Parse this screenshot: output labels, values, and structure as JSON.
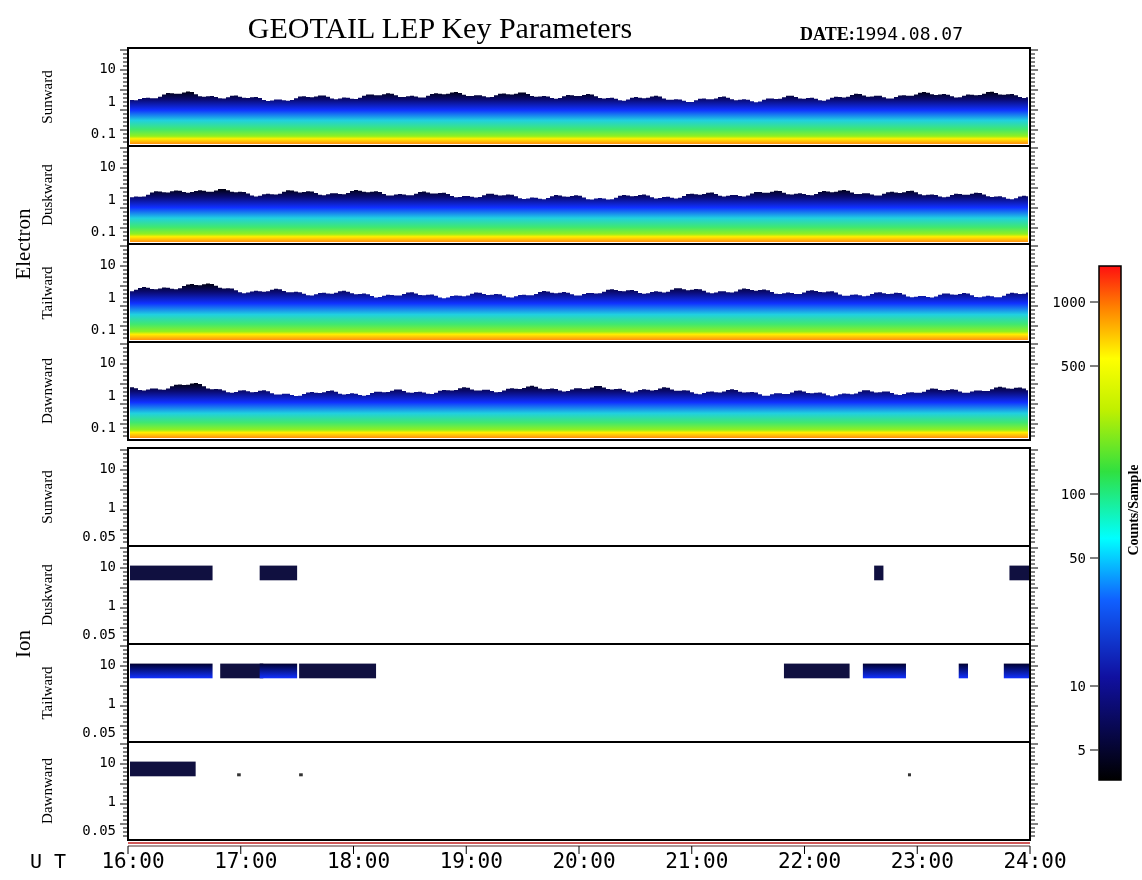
{
  "title": "GEOTAIL LEP Key Parameters",
  "date": {
    "label": "DATE:",
    "value": "1994.08.07"
  },
  "groups": [
    {
      "name": "Electron",
      "kind": "band",
      "panels": [
        {
          "label": "Sunward",
          "yticks": [
            "10",
            "1",
            "0.1"
          ]
        },
        {
          "label": "Duskward",
          "yticks": [
            "10",
            "1",
            "0.1"
          ]
        },
        {
          "label": "Tailward",
          "yticks": [
            "10",
            "1",
            "0.1"
          ]
        },
        {
          "label": "Dawnward",
          "yticks": [
            "10",
            "1",
            "0.1"
          ]
        }
      ]
    },
    {
      "name": "Ion",
      "kind": "sparse",
      "panels": [
        {
          "label": "Sunward",
          "yticks": [
            "10",
            "1",
            "0.05"
          ]
        },
        {
          "label": "Duskward",
          "yticks": [
            "10",
            "1",
            "0.05"
          ]
        },
        {
          "label": "Tailward",
          "yticks": [
            "10",
            "1",
            "0.05"
          ]
        },
        {
          "label": "Dawnward",
          "yticks": [
            "10",
            "1",
            "0.05"
          ]
        }
      ]
    }
  ],
  "time_axis": {
    "label": "U T",
    "ticks": [
      "16:00",
      "17:00",
      "18:00",
      "19:00",
      "20:00",
      "21:00",
      "22:00",
      "23:00",
      "24:00"
    ]
  },
  "colorbar": {
    "label": "Counts/Sample",
    "ticks": [
      "1000",
      "500",
      "100",
      "50",
      "10",
      "5"
    ]
  }
}
